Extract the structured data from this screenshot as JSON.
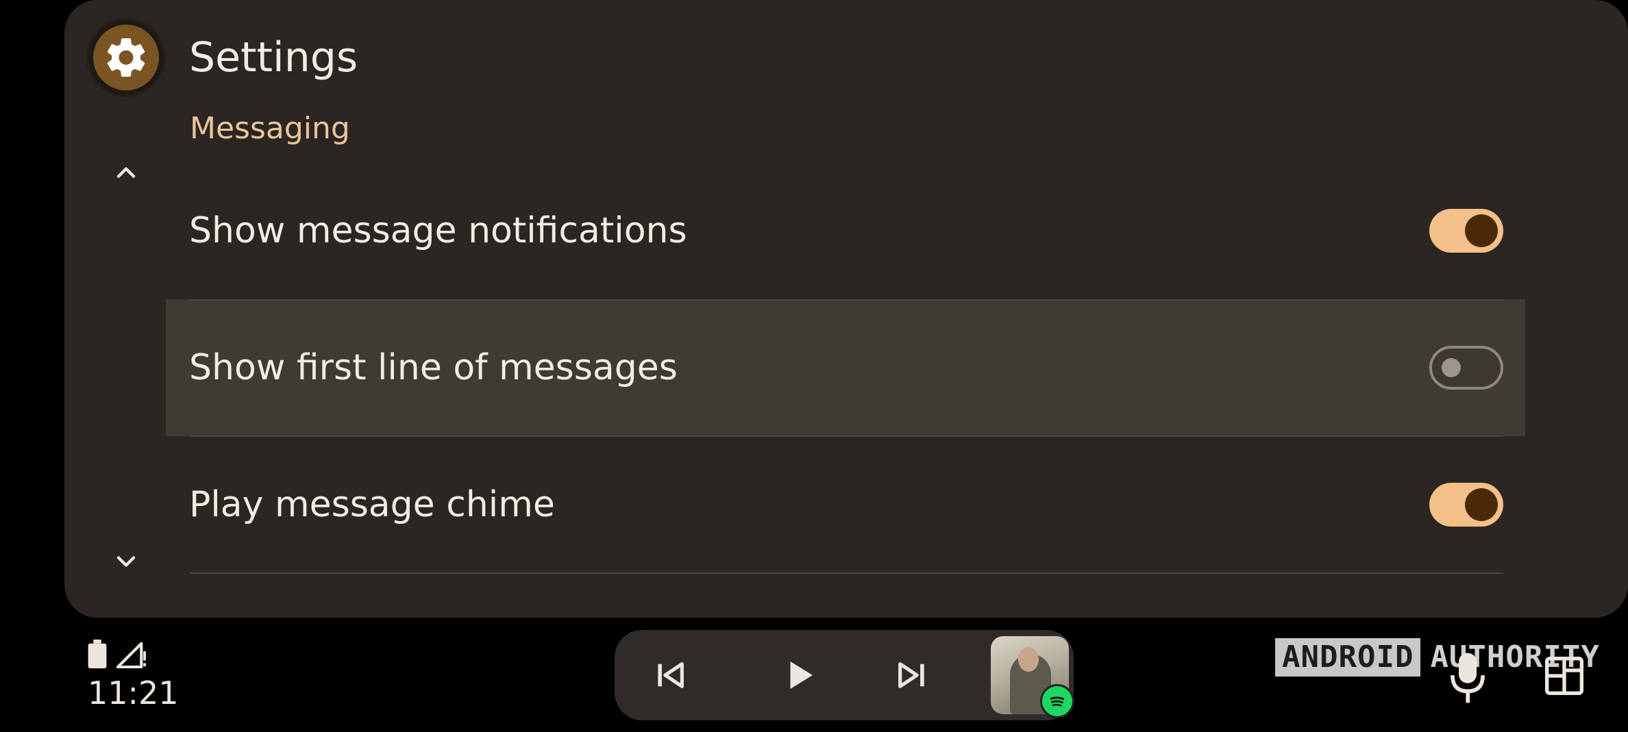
{
  "header": {
    "title": "Settings",
    "app_icon": "gear-icon"
  },
  "section": {
    "title": "Messaging"
  },
  "settings": [
    {
      "label": "Show message notifications",
      "enabled": true
    },
    {
      "label": "Show first line of messages",
      "enabled": false
    },
    {
      "label": "Play message chime",
      "enabled": true
    }
  ],
  "nav": {
    "scroll_up_icon": "chevron-up-icon",
    "scroll_down_icon": "chevron-down-icon"
  },
  "status_bar": {
    "time": "11:21",
    "battery_icon": "battery-icon",
    "signal_icon": "signal-alert-icon"
  },
  "media": {
    "previous_icon": "skip-previous-icon",
    "play_icon": "play-icon",
    "next_icon": "skip-next-icon",
    "source_icon": "spotify-icon"
  },
  "watermark": {
    "boxed": "ANDROID",
    "text": "AUTHORITY"
  },
  "actions": {
    "voice_icon": "microphone-icon",
    "launcher_icon": "app-grid-icon"
  },
  "colors": {
    "accent": "#f5bf8a",
    "section_heading": "#eac59c",
    "panel_bg": "#2b2622",
    "toggle_knob_on": "#4a2a06",
    "spotify_green": "#1ed760"
  }
}
